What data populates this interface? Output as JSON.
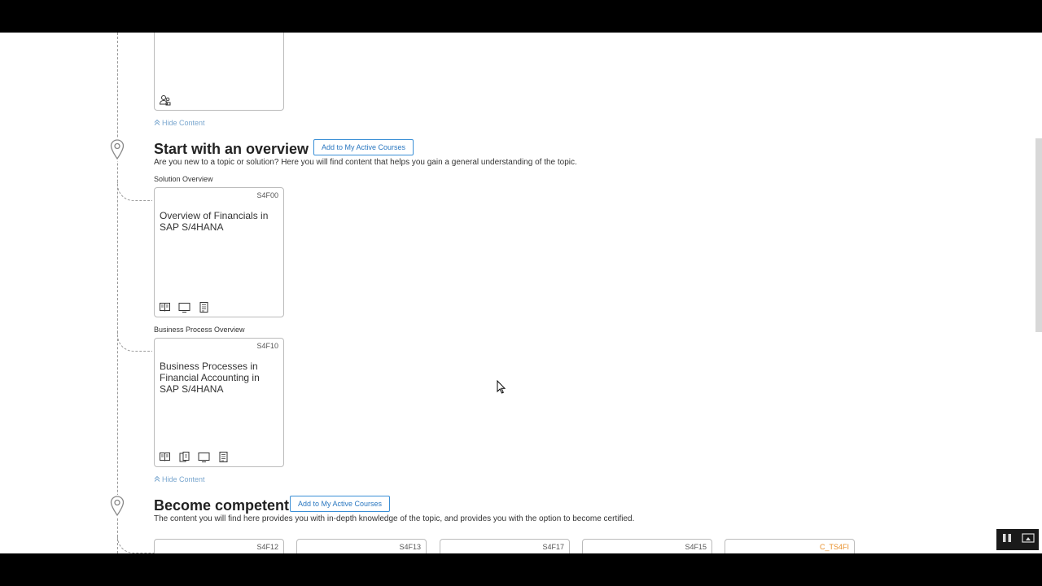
{
  "content": {
    "hide_content": "Hide Content",
    "sections": [
      {
        "title": "Start with an overview",
        "add_button": "Add to My Active Courses",
        "description": "Are you new to a topic or solution? Here you will find content that helps you gain a general understanding of the topic.",
        "cards": [
          {
            "label": "Solution Overview",
            "code": "S4F00",
            "title": "Overview of Financials in SAP S/4HANA",
            "icons": [
              "book-icon",
              "monitor-icon",
              "document-icon"
            ]
          },
          {
            "label": "Business Process Overview",
            "code": "S4F10",
            "title": "Business Processes in Financial Accounting in SAP S/4HANA",
            "icons": [
              "book-icon",
              "copy-icon",
              "monitor-icon",
              "document-icon"
            ]
          }
        ]
      },
      {
        "title": "Become competent",
        "add_button": "Add to My Active Courses",
        "description": "The content you will find here provides you with in-depth knowledge of the topic, and provides you with the option to become certified.",
        "codes": [
          "S4F12",
          "S4F13",
          "S4F17",
          "S4F15",
          "C_TS4FI"
        ]
      }
    ],
    "top_card_icon": "people-icon"
  },
  "colors": {
    "link": "#7aa7cf",
    "button_border": "#3a8fd6",
    "cert_code": "#e8902b"
  },
  "video_controls": [
    "pause-icon",
    "picture-in-picture-icon"
  ]
}
